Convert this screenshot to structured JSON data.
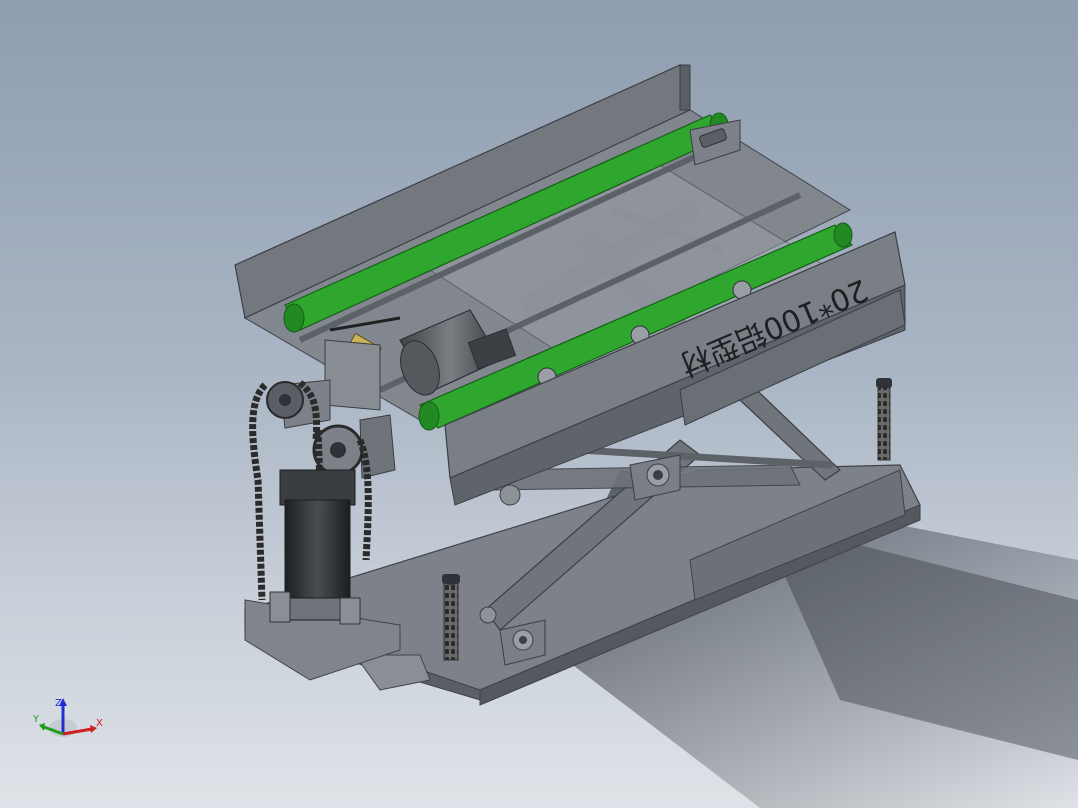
{
  "model": {
    "profile_label": "20*100铝型材"
  },
  "triad": {
    "x_label": "X",
    "y_label": "Y",
    "z_label": "Z"
  },
  "colors": {
    "background_top": "#8f9db0",
    "background_bottom": "#dfe3e8",
    "frame": "#6f737a",
    "frame_dark": "#4b4f56",
    "belt": "#2fa72f",
    "chain": "#2b2b2b",
    "axis_x": "#d11f1f",
    "axis_y": "#1f9d1f",
    "axis_z": "#1f2fd1"
  }
}
